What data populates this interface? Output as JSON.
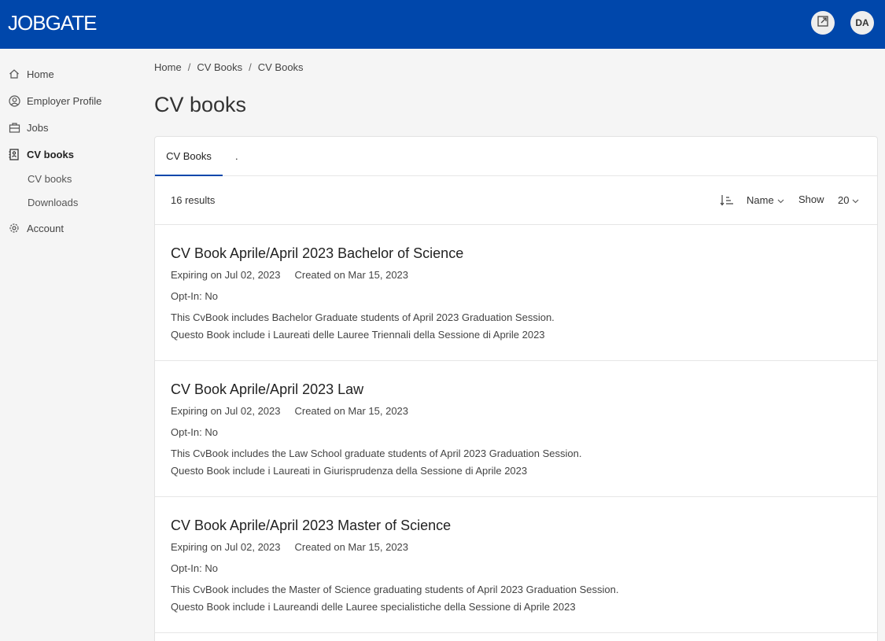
{
  "header": {
    "brand": "JOBGATE",
    "avatar_initials": "DA",
    "external_icon": "external-link-icon",
    "bar_color": "#0047ab"
  },
  "sidebar": {
    "items": [
      {
        "label": "Home",
        "icon": "home-icon"
      },
      {
        "label": "Employer Profile",
        "icon": "user-circle-icon"
      },
      {
        "label": "Jobs",
        "icon": "briefcase-icon"
      },
      {
        "label": "CV books",
        "icon": "contact-book-icon"
      },
      {
        "label": "Account",
        "icon": "gear-icon"
      }
    ],
    "sub_items": [
      "CV books",
      "Downloads"
    ]
  },
  "breadcrumb": [
    "Home",
    "CV Books",
    "CV Books"
  ],
  "page_title": "CV books",
  "tabs": [
    "CV Books",
    "."
  ],
  "toolbar": {
    "results": "16 results",
    "sort_label": "Name",
    "show_label": "Show",
    "show_value": "20"
  },
  "items": [
    {
      "title": "CV Book Aprile/April 2023 Bachelor of Science",
      "expiring": "Expiring on Jul 02, 2023",
      "created": "Created on Mar 15, 2023",
      "optin": "Opt-In: No",
      "desc1": "This CvBook includes Bachelor Graduate students of April 2023 Graduation Session.",
      "desc2": "Questo Book include i Laureati delle Lauree Triennali della Sessione di Aprile 2023"
    },
    {
      "title": "CV Book Aprile/April 2023 Law",
      "expiring": "Expiring on Jul 02, 2023",
      "created": "Created on Mar 15, 2023",
      "optin": "Opt-In: No",
      "desc1": "This CvBook includes the Law School graduate students of April 2023 Graduation Session.",
      "desc2": "Questo Book include i Laureati in Giurisprudenza della Sessione di Aprile 2023"
    },
    {
      "title": "CV Book Aprile/April 2023 Master of Science",
      "expiring": "Expiring on Jul 02, 2023",
      "created": "Created on Mar 15, 2023",
      "optin": "Opt-In: No",
      "desc1": "This CvBook includes the Master of Science graduating students of April 2023 Graduation Session.",
      "desc2": "Questo Book include i Laureandi delle Lauree specialistiche della Sessione di Aprile 2023"
    }
  ]
}
